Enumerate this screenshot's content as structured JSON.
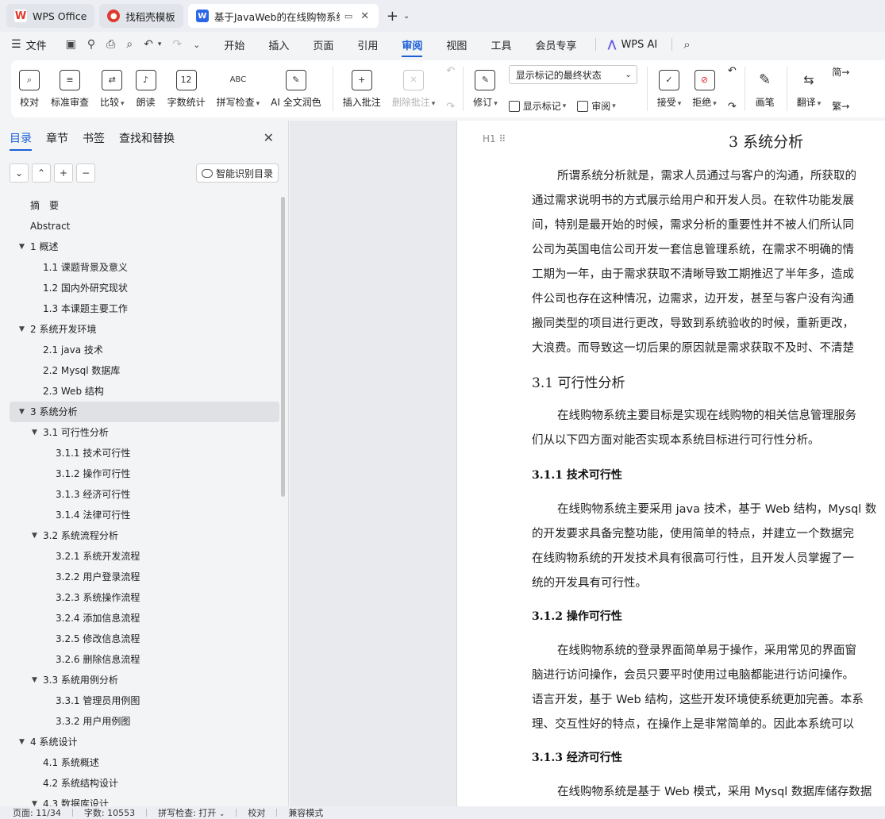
{
  "tabs": [
    {
      "label": "WPS Office",
      "icon": "wps-logo-icon"
    },
    {
      "label": "找稻壳模板",
      "icon": "daoke-icon"
    },
    {
      "label": "基于JavaWeb的在线购物系统",
      "icon": "word-doc-icon",
      "active": true
    }
  ],
  "menubar": {
    "file_label": "文件",
    "tabs": [
      "开始",
      "插入",
      "页面",
      "引用",
      "审阅",
      "视图",
      "工具",
      "会员专享"
    ],
    "active_tab": "审阅",
    "ai_label": "WPS AI"
  },
  "ribbon": {
    "proofread": "校对",
    "standard_review": "标准审查",
    "compare": "比较",
    "read_aloud": "朗读",
    "word_count": "字数统计",
    "spell_check": "拼写检查",
    "ai_polish": "AI 全文润色",
    "insert_comment": "插入批注",
    "delete_comment": "删除批注",
    "revise": "修订",
    "markup_select": "显示标记的最终状态",
    "show_markup": "显示标记",
    "review": "审阅",
    "accept": "接受",
    "reject": "拒绝",
    "draw": "画笔",
    "translate": "翻译",
    "simp": "简",
    "trad": "繁"
  },
  "nav": {
    "tabs": [
      "目录",
      "章节",
      "书签",
      "查找和替换"
    ],
    "active_tab": "目录",
    "smart_toc": "智能识别目录",
    "toc": [
      {
        "label": "摘　要",
        "level": 0
      },
      {
        "label": "Abstract",
        "level": 0
      },
      {
        "label": "1  概述",
        "level": 1,
        "expanded": true
      },
      {
        "label": "1.1 课题背景及意义",
        "level": 2
      },
      {
        "label": "1.2  国内外研究现状",
        "level": 2
      },
      {
        "label": "1.3  本课题主要工作",
        "level": 2
      },
      {
        "label": "2  系统开发环境",
        "level": 1,
        "expanded": true
      },
      {
        "label": "2.1 java 技术",
        "level": 2
      },
      {
        "label": "2.2 Mysql 数据库",
        "level": 2
      },
      {
        "label": "2.3 Web 结构",
        "level": 2
      },
      {
        "label": "3  系统分析",
        "level": 1,
        "expanded": true,
        "selected": true
      },
      {
        "label": "3.1  可行性分析",
        "level": 2,
        "expanded": true
      },
      {
        "label": "3.1.1  技术可行性",
        "level": 3
      },
      {
        "label": "3.1.2 操作可行性",
        "level": 3
      },
      {
        "label": "3.1.3  经济可行性",
        "level": 3
      },
      {
        "label": "3.1.4  法律可行性",
        "level": 3
      },
      {
        "label": "3.2 系统流程分析",
        "level": 2,
        "expanded": true
      },
      {
        "label": "3.2.1 系统开发流程",
        "level": 3
      },
      {
        "label": "3.2.2  用户登录流程",
        "level": 3
      },
      {
        "label": "3.2.3  系统操作流程",
        "level": 3
      },
      {
        "label": "3.2.4  添加信息流程",
        "level": 3
      },
      {
        "label": "3.2.5  修改信息流程",
        "level": 3
      },
      {
        "label": "3.2.6  删除信息流程",
        "level": 3
      },
      {
        "label": "3.3 系统用例分析",
        "level": 2,
        "expanded": true
      },
      {
        "label": "3.3.1 管理员用例图",
        "level": 3
      },
      {
        "label": "3.3.2 用户用例图",
        "level": 3
      },
      {
        "label": "4  系统设计",
        "level": 1,
        "expanded": true
      },
      {
        "label": "4.1  系统概述",
        "level": 2
      },
      {
        "label": "4.2  系统结构设计",
        "level": 2
      },
      {
        "label": "4.3 数据库设计",
        "level": 2,
        "expanded": true
      }
    ]
  },
  "document": {
    "h1": "3  系统分析",
    "heading_marker": "H1",
    "p1": [
      "所谓系统分析就是，需求人员通过与客户的沟通，所获取的",
      "通过需求说明书的方式展示给用户和开发人员。在软件功能发展",
      "间，特别是最开始的时候，需求分析的重要性并不被人们所认同",
      "公司为英国电信公司开发一套信息管理系统，在需求不明确的情",
      "工期为一年，由于需求获取不清晰导致工期推迟了半年多，造成",
      "件公司也存在这种情况，边需求，边开发，甚至与客户没有沟通",
      "搬同类型的项目进行更改，导致到系统验收的时候，重新更改，",
      "大浪费。而导致这一切后果的原因就是需求获取不及时、不清楚"
    ],
    "h2": "3.1  可行性分析",
    "p2": [
      "在线购物系统主要目标是实现在线购物的相关信息管理服务",
      "们从以下四方面对能否实现本系统目标进行可行性分析。"
    ],
    "h3a": "3.1.1  技术可行性",
    "p3": [
      "在线购物系统主要采用 java 技术，基于 Web 结构，Mysql 数",
      "的开发要求具备完整功能，使用简单的特点，并建立一个数据完",
      "在线购物系统的开发技术具有很高可行性，且开发人员掌握了一",
      "统的开发具有可行性。"
    ],
    "h3b": "3.1.2 操作可行性",
    "p4": [
      "在线购物系统的登录界面简单易于操作，采用常见的界面窗",
      "脑进行访问操作，会员只要平时使用过电脑都能进行访问操作。",
      "语言开发，基于 Web 结构，这些开发环境使系统更加完善。本系",
      "理、交互性好的特点，在操作上是非常简单的。因此本系统可以"
    ],
    "h3c": "3.1.3  经济可行性",
    "p5": [
      "在线购物系统是基于 Web 模式，采用 Mysql 数据库储存数据"
    ]
  },
  "status": {
    "page": "页面: 11/34",
    "words": "字数: 10553",
    "spell": "拼写检查: 打开",
    "proof": "校对",
    "compat": "兼容模式"
  },
  "colors": {
    "accent": "#1a5fd8",
    "wps_red": "#e03a2f",
    "word_blue": "#2b66e8",
    "ai_purple": "#5a4fe6"
  }
}
